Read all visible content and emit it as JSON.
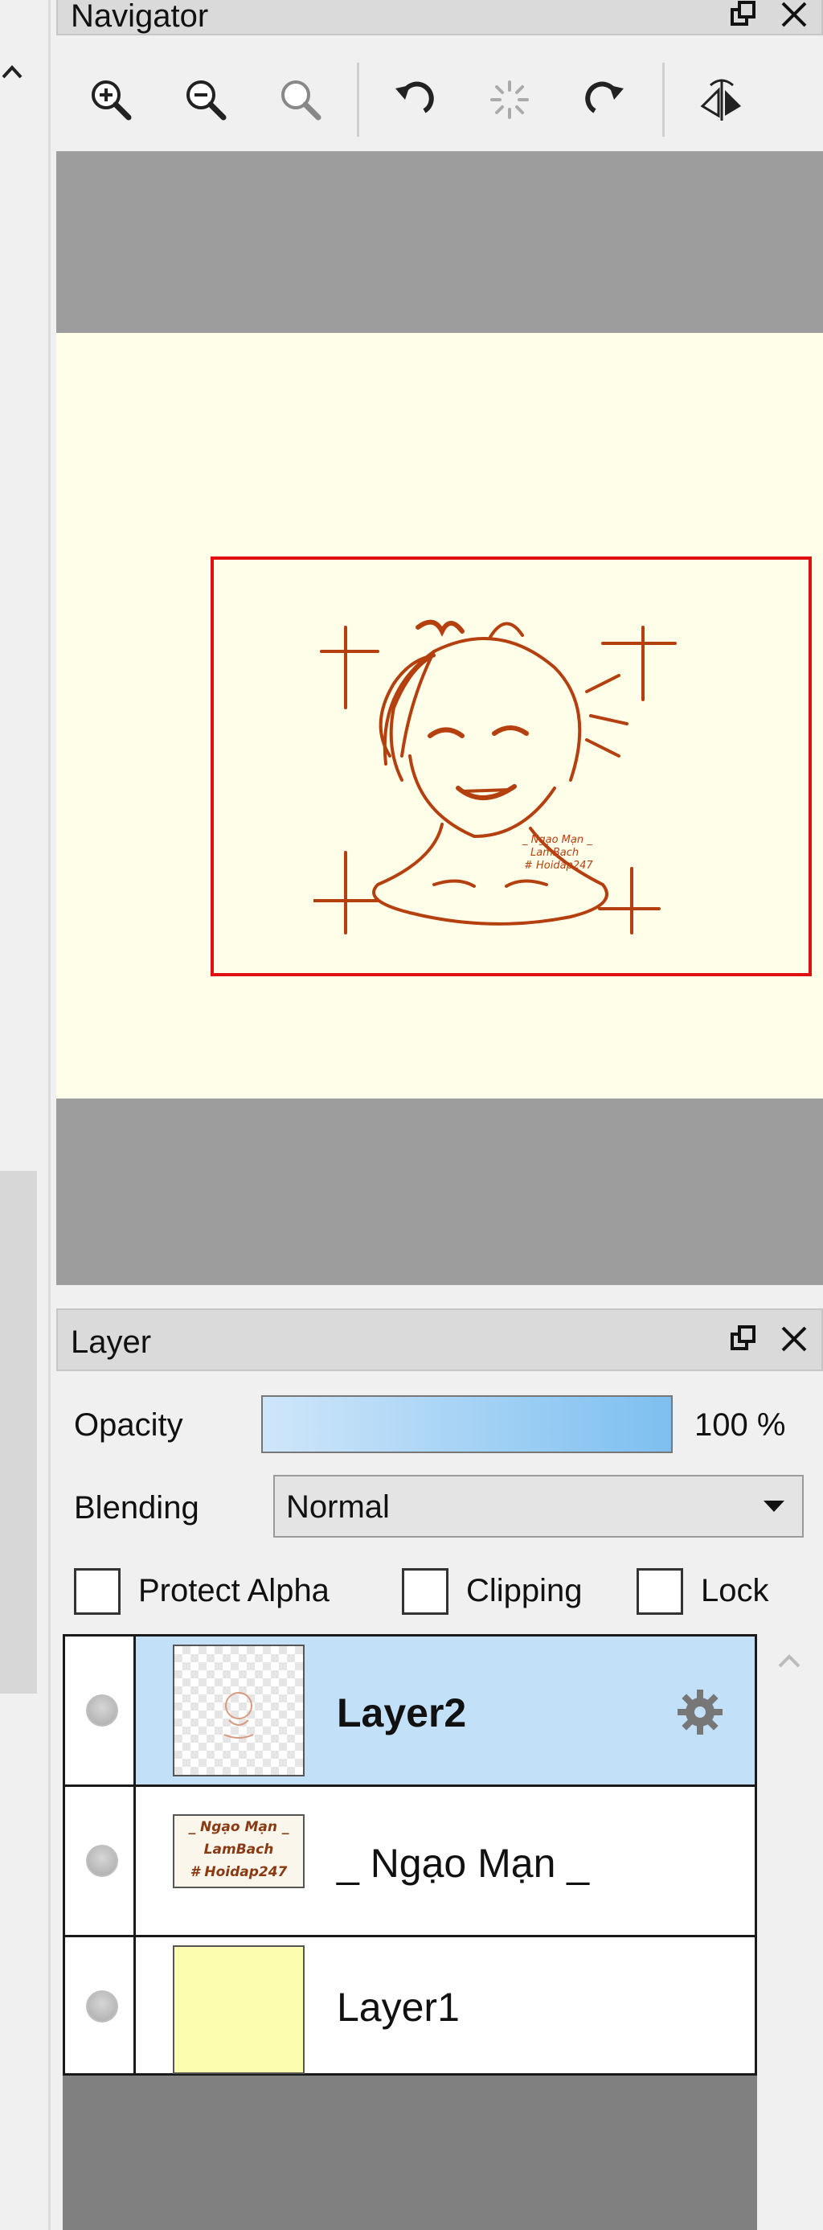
{
  "navigator": {
    "title": "Navigator",
    "tools": [
      {
        "icon": "zoom-in-icon"
      },
      {
        "icon": "zoom-out-icon"
      },
      {
        "icon": "zoom-fit-icon"
      },
      {
        "icon": "rotate-left-icon"
      },
      {
        "icon": "rotate-reset-icon"
      },
      {
        "icon": "rotate-right-icon"
      },
      {
        "icon": "flip-horizontal-icon"
      }
    ],
    "artwork_caption_lines": [
      "_ Ngạo Mạn _",
      "LamBach",
      "# Hoidap247"
    ]
  },
  "layer_panel": {
    "title": "Layer",
    "opacity_label": "Opacity",
    "opacity_value_text": "100 %",
    "opacity_fraction": 1.0,
    "blending_label": "Blending",
    "blending_value": "Normal",
    "protect_alpha_label": "Protect Alpha",
    "clipping_label": "Clipping",
    "lock_label": "Lock",
    "layers": [
      {
        "name": "Layer2",
        "selected": true,
        "thumbnail": "transparent-sketch"
      },
      {
        "name": "_ Ngạo Mạn _",
        "selected": false,
        "thumbnail": "text",
        "thumb_text": [
          "_ Ngạo Mạn _",
          "LamBach",
          "# Hoidap247"
        ]
      },
      {
        "name": "Layer1",
        "selected": false,
        "thumbnail": "solid-yellow"
      }
    ]
  },
  "colors": {
    "selected_row": "#c2e0f8",
    "canvas_paper": "#fffee8",
    "sketch_line": "#b5400f",
    "view_rect": "#e01010"
  }
}
